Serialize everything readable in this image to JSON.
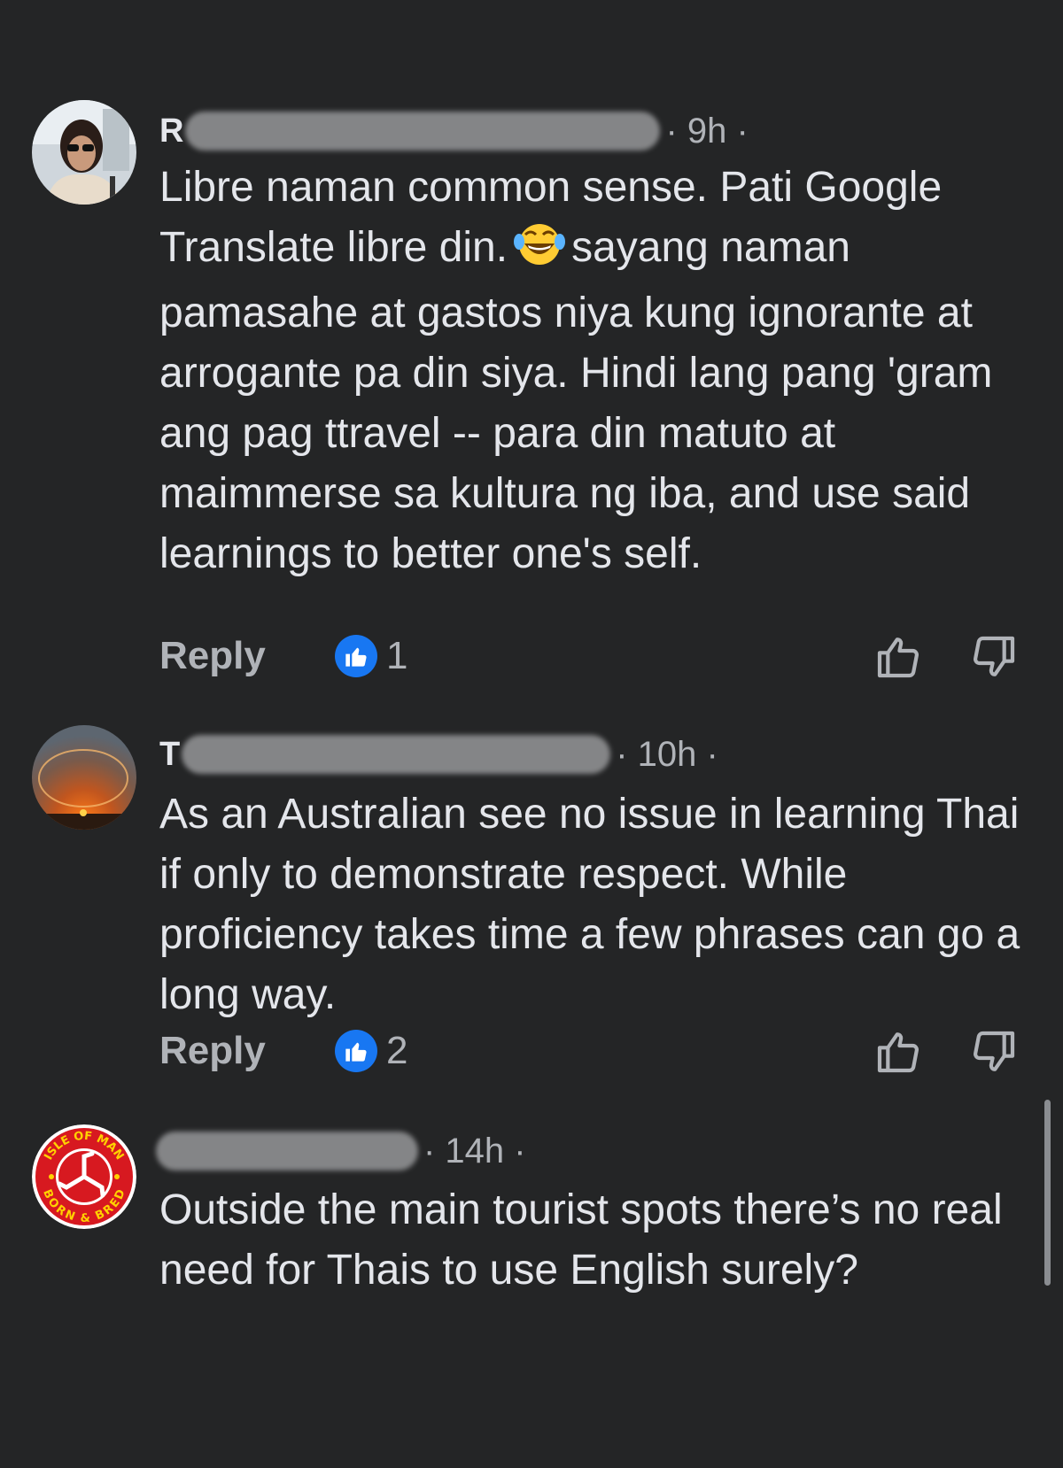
{
  "comments": [
    {
      "initial": "R",
      "time": "· 9h ·",
      "body_before_emoji": "Libre naman common sense. Pati Google Translate libre din.",
      "emoji": "face-with-tears-of-joy",
      "body_after_emoji": "sayang naman pamasahe at gastos niya kung ignorante at arrogante pa din siya. Hindi lang pang 'gram ang pag ttravel -- para din matuto at maimmerse sa kultura ng iba, and use said learnings to better one's self.",
      "reply_label": "Reply",
      "like_count": "1"
    },
    {
      "initial": "T",
      "time": "· 10h ·",
      "body": "As an Australian see no issue in learning Thai if only to demonstrate respect. While proficiency takes time a few phrases can go a long way.",
      "reply_label": "Reply",
      "like_count": "2"
    },
    {
      "initial": "",
      "time": "· 14h ·",
      "body": "Outside the main tourist spots there’s no real need for Thais to use English surely?",
      "avatar_top_text": "ISLE OF MAN",
      "avatar_bottom_text": "BORN & BRED"
    }
  ],
  "icons": {
    "like_badge": "thumbs-up-icon",
    "upvote": "thumbs-up-outline-icon",
    "downvote": "thumbs-down-outline-icon"
  },
  "colors": {
    "background": "#242526",
    "text_primary": "#e4e6eb",
    "text_secondary": "#b0b3b8",
    "like_blue": "#1877f2"
  }
}
